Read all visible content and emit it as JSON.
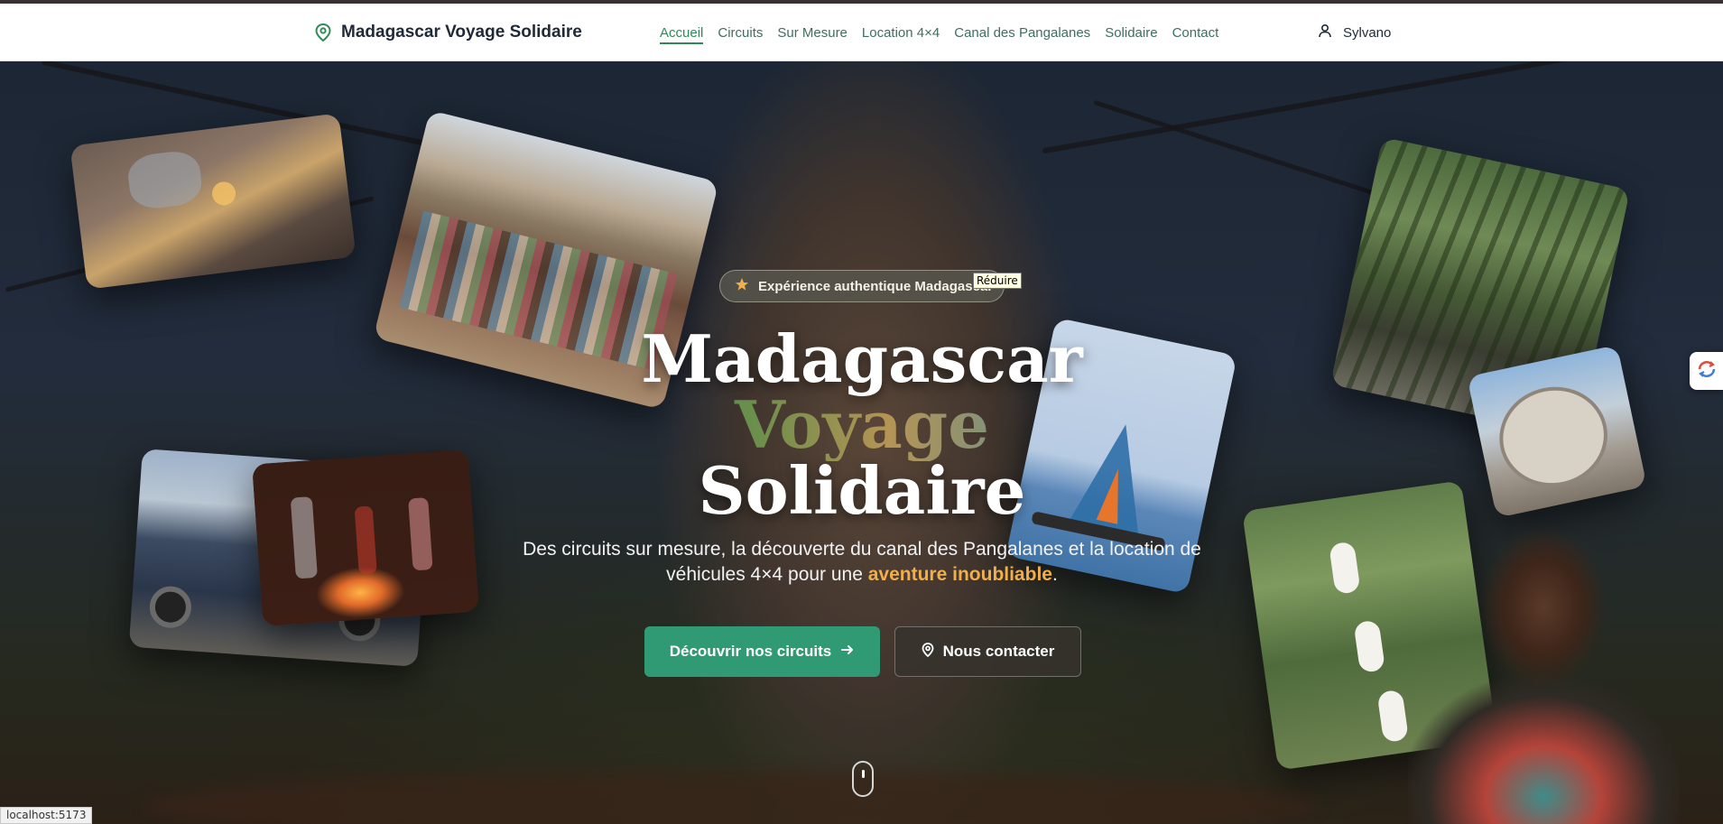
{
  "header": {
    "brand_name": "Madagascar Voyage Solidaire",
    "brand_icon": "map-pin-icon",
    "nav": [
      {
        "label": "Accueil",
        "active": true
      },
      {
        "label": "Circuits",
        "active": false
      },
      {
        "label": "Sur Mesure",
        "active": false
      },
      {
        "label": "Location 4×4",
        "active": false
      },
      {
        "label": "Canal des Pangalanes",
        "active": false
      },
      {
        "label": "Solidaire",
        "active": false
      },
      {
        "label": "Contact",
        "active": false
      }
    ],
    "user_icon": "user-icon",
    "user_name": "Sylvano"
  },
  "hero": {
    "badge_icon": "star-icon",
    "badge_text": "Expérience authentique Madagascar",
    "tooltip": "Réduire",
    "title_line1": "Madagascar",
    "title_line2": "Voyage",
    "title_line3": "Solidaire",
    "subtitle_before": "Des circuits sur mesure, la découverte du canal des Pangalanes et la location de véhicules 4×4 pour une ",
    "subtitle_highlight": "aventure inoubliable",
    "subtitle_after": ".",
    "primary_button": "Découvrir nos circuits",
    "secondary_button": "Nous contacter"
  },
  "photos": [
    "sunset-rock-photo",
    "children-group-photo",
    "4x4-vehicle-photo",
    "campfire-photo",
    "pirogue-sail-photo",
    "forest-trail-photo",
    "parc-national-sign-photo",
    "lemurs-photo",
    "local-woman-photo"
  ],
  "status_bar_url": "localhost:5173",
  "colors": {
    "accent_green": "#2f9a74",
    "highlight_orange": "#f0ae4c",
    "nav_active": "#2e8b57"
  }
}
